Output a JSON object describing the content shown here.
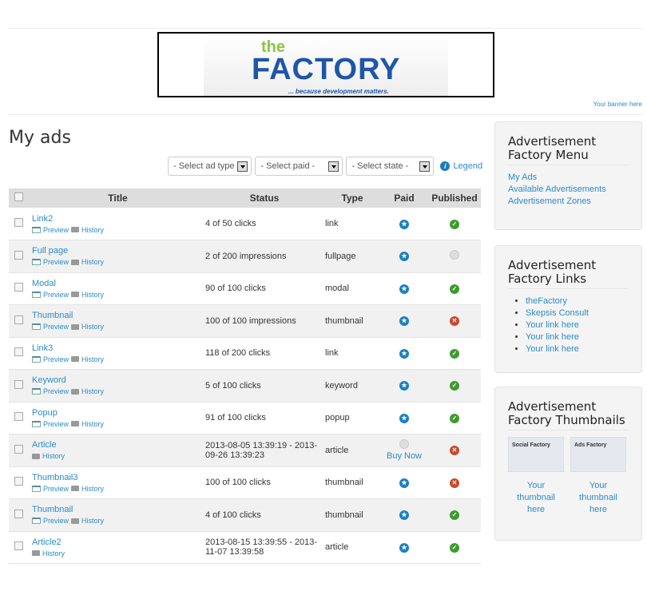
{
  "banner": {
    "logo_the": "the",
    "logo_factory": "FACTORY",
    "logo_tagline": "... because development matters.",
    "your_banner": "Your banner here"
  },
  "page_title": "My ads",
  "filters": {
    "ad_type": "- Select ad type",
    "paid": "- Select paid -",
    "state": "- Select state -",
    "legend": "Legend"
  },
  "table": {
    "headers": [
      "Title",
      "Status",
      "Type",
      "Paid",
      "Published"
    ],
    "preview_label": "Preview",
    "history_label": "History",
    "buy_now_label": "Buy Now",
    "rows": [
      {
        "title": "Link2",
        "preview": true,
        "status": "4 of 50 clicks",
        "type": "link",
        "paid": "paid",
        "published": "yes"
      },
      {
        "title": "Full page",
        "preview": true,
        "status": "2 of 200 impressions",
        "type": "fullpage",
        "paid": "paid",
        "published": "pending"
      },
      {
        "title": "Modal",
        "preview": true,
        "status": "90 of 100 clicks",
        "type": "modal",
        "paid": "paid",
        "published": "yes"
      },
      {
        "title": "Thumbnail",
        "preview": true,
        "status": "100 of 100 impressions",
        "type": "thumbnail",
        "paid": "paid",
        "published": "no"
      },
      {
        "title": "Link3",
        "preview": true,
        "status": "118 of 200 clicks",
        "type": "link",
        "paid": "paid",
        "published": "yes"
      },
      {
        "title": "Keyword",
        "preview": true,
        "status": "5 of 100 clicks",
        "type": "keyword",
        "paid": "paid",
        "published": "yes"
      },
      {
        "title": "Popup",
        "preview": true,
        "status": "91 of 100 clicks",
        "type": "popup",
        "paid": "paid",
        "published": "yes"
      },
      {
        "title": "Article",
        "preview": false,
        "status": "2013-08-05 13:39:19 - 2013-09-26 13:39:23",
        "type": "article",
        "paid": "unpaid",
        "published": "no"
      },
      {
        "title": "Thumbnail3",
        "preview": true,
        "status": "100 of 100 clicks",
        "type": "thumbnail",
        "paid": "paid",
        "published": "no"
      },
      {
        "title": "Thumbnail",
        "preview": true,
        "status": "4 of 100 clicks",
        "type": "thumbnail",
        "paid": "paid",
        "published": "yes"
      },
      {
        "title": "Article2",
        "preview": false,
        "status": "2013-08-15 13:39:55 - 2013-11-07 13:39:58",
        "type": "article",
        "paid": "paid",
        "published": "yes"
      }
    ]
  },
  "sidebar": {
    "menu": {
      "title": "Advertisement Factory Menu",
      "items": [
        "My Ads",
        "Available Advertisements",
        "Advertisement Zones"
      ]
    },
    "links": {
      "title": "Advertisement Factory Links",
      "items": [
        "theFactory",
        "Skepsis Consult",
        "Your link here",
        "Your link here",
        "Your link here"
      ]
    },
    "thumbnails": {
      "title": "Advertisement Factory Thumbnails",
      "items": [
        {
          "img": "Social Factory",
          "label": "Your thumbnail here"
        },
        {
          "img": "Ads Factory",
          "label": "Your thumbnail here"
        }
      ]
    }
  },
  "colors": {
    "link": "#2a8bc8",
    "paid": "#1a80c0",
    "published": "#3e9a2d",
    "unpublished": "#c9462c"
  }
}
